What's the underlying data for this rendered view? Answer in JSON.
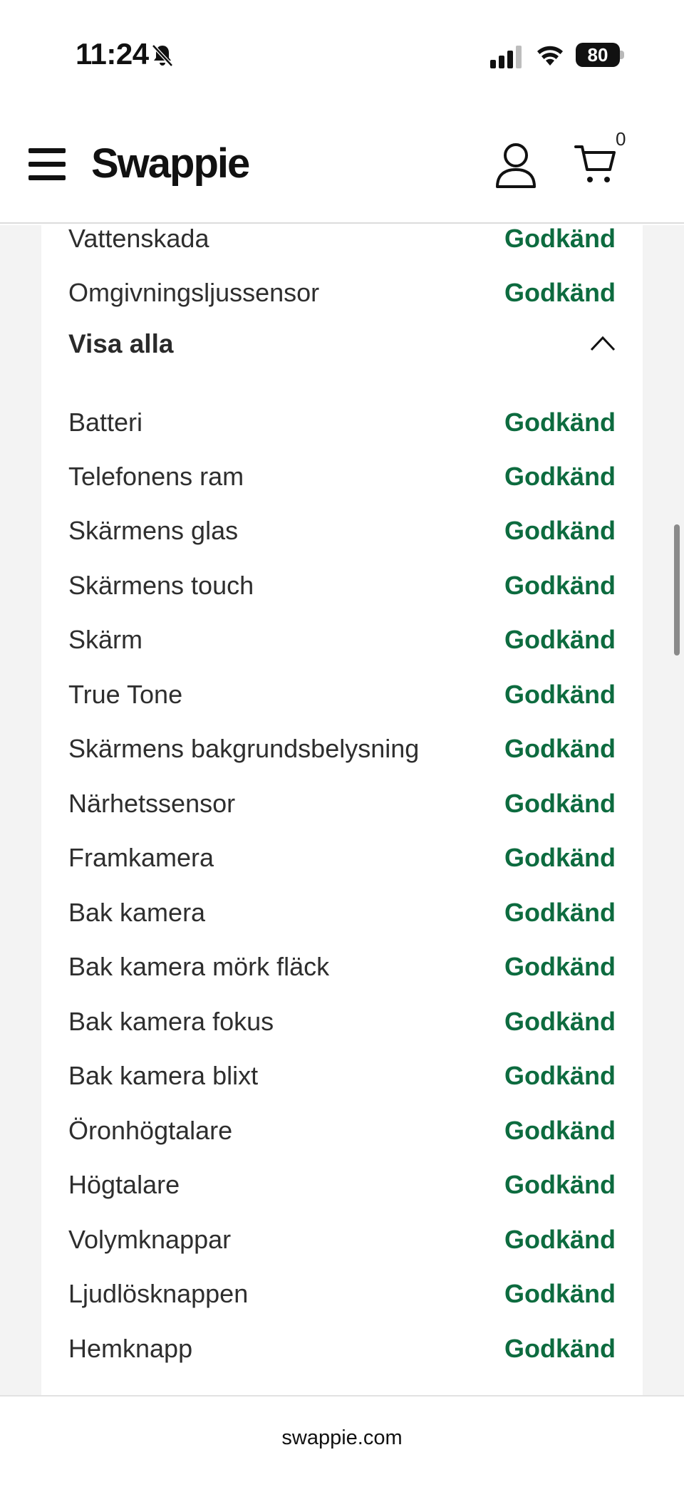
{
  "status_bar": {
    "time": "11:24",
    "battery": "80",
    "icons": [
      "bell-slash-icon",
      "signal-icon",
      "wifi-icon",
      "battery-icon"
    ]
  },
  "header": {
    "logo": "Swappie",
    "cart_count": "0",
    "icons": [
      "hamburger-menu-icon",
      "user-icon",
      "cart-icon"
    ]
  },
  "checks_top": [
    {
      "label": "Vattenskada",
      "status": "Godkänd"
    },
    {
      "label": "Omgivningsljussensor",
      "status": "Godkänd"
    }
  ],
  "toggle": {
    "label": "Visa alla",
    "icon": "chevron-up-icon"
  },
  "checks": [
    {
      "label": "Batteri",
      "status": "Godkänd"
    },
    {
      "label": "Telefonens ram",
      "status": "Godkänd"
    },
    {
      "label": "Skärmens glas",
      "status": "Godkänd"
    },
    {
      "label": "Skärmens touch",
      "status": "Godkänd"
    },
    {
      "label": "Skärm",
      "status": "Godkänd"
    },
    {
      "label": "True Tone",
      "status": "Godkänd"
    },
    {
      "label": "Skärmens bakgrundsbelysning",
      "status": "Godkänd"
    },
    {
      "label": "Närhetssensor",
      "status": "Godkänd"
    },
    {
      "label": "Framkamera",
      "status": "Godkänd"
    },
    {
      "label": "Bak kamera",
      "status": "Godkänd"
    },
    {
      "label": "Bak kamera mörk fläck",
      "status": "Godkänd"
    },
    {
      "label": "Bak kamera fokus",
      "status": "Godkänd"
    },
    {
      "label": "Bak kamera blixt",
      "status": "Godkänd"
    },
    {
      "label": "Öronhögtalare",
      "status": "Godkänd"
    },
    {
      "label": "Högtalare",
      "status": "Godkänd"
    },
    {
      "label": "Volymknappar",
      "status": "Godkänd"
    },
    {
      "label": "Ljudlösknappen",
      "status": "Godkänd"
    },
    {
      "label": "Hemknapp",
      "status": "Godkänd"
    }
  ],
  "browser": {
    "url": "swappie.com"
  },
  "colors": {
    "pass": "#0d6b3f",
    "page_bg": "#f3f3f3",
    "card": "#ffffff"
  }
}
